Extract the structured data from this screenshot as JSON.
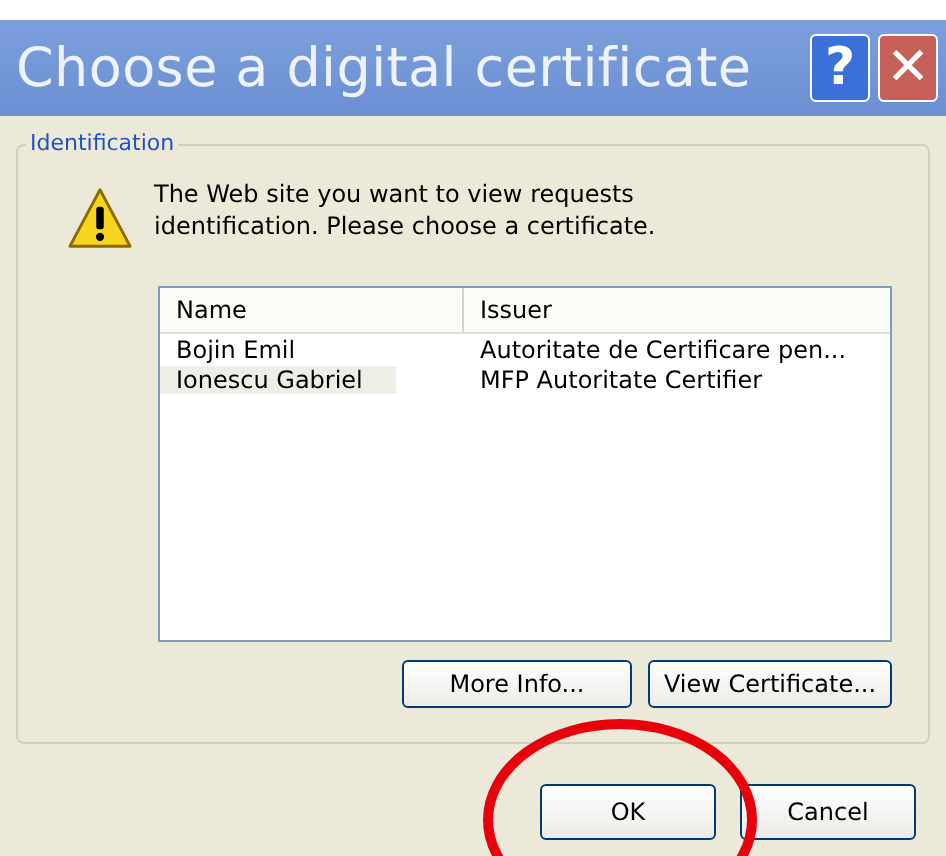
{
  "window": {
    "title": "Choose a digital certificate",
    "help": "?",
    "close": "✕"
  },
  "group": {
    "legend": "Identification",
    "message": "The Web site you want to view requests identification. Please choose a certificate."
  },
  "table": {
    "columns": [
      "Name",
      "Issuer"
    ],
    "rows": [
      {
        "name": "Bojin Emil",
        "issuer": "Autoritate de Certificare pen...",
        "selected": false
      },
      {
        "name": "Ionescu Gabriel",
        "issuer": "MFP Autoritate Certifier",
        "selected": true
      }
    ]
  },
  "list_buttons": [
    "More Info...",
    "View Certificate..."
  ],
  "buttons": [
    "OK",
    "Cancel"
  ]
}
